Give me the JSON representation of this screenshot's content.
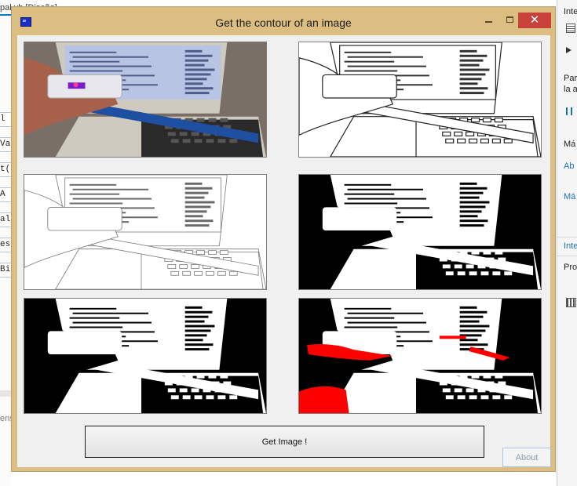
{
  "ide": {
    "doc_tab": "pal.vb [Diseño]",
    "left_stubs": [
      "l",
      "Val",
      "t((",
      "  A",
      "al",
      "es",
      " Bit"
    ],
    "left_truncated": "ens",
    "right": {
      "header": "Inte",
      "line1": "Par",
      "line2": "la a",
      "label_ma": "Má",
      "link_ab": "Ab",
      "link_ma": "Má",
      "section": "Inte",
      "section2": "Pro"
    }
  },
  "window": {
    "title": "Get the contour of an image",
    "minimize_glyph": "",
    "maximize_glyph": "",
    "close_glyph": "✕"
  },
  "images": [
    {
      "name": "original",
      "mode": "photo"
    },
    {
      "name": "sketch",
      "mode": "sketch"
    },
    {
      "name": "edges",
      "mode": "edges"
    },
    {
      "name": "threshold",
      "mode": "threshold"
    },
    {
      "name": "binary",
      "mode": "binary"
    },
    {
      "name": "contour-highlight",
      "mode": "highlight",
      "highlight_color": "#ff0000"
    }
  ],
  "buttons": {
    "get_image": "Get Image !",
    "about": "About"
  },
  "colors": {
    "window_frame": "#dcbd82",
    "close_button": "#c8413a",
    "accent": "#007acc"
  }
}
